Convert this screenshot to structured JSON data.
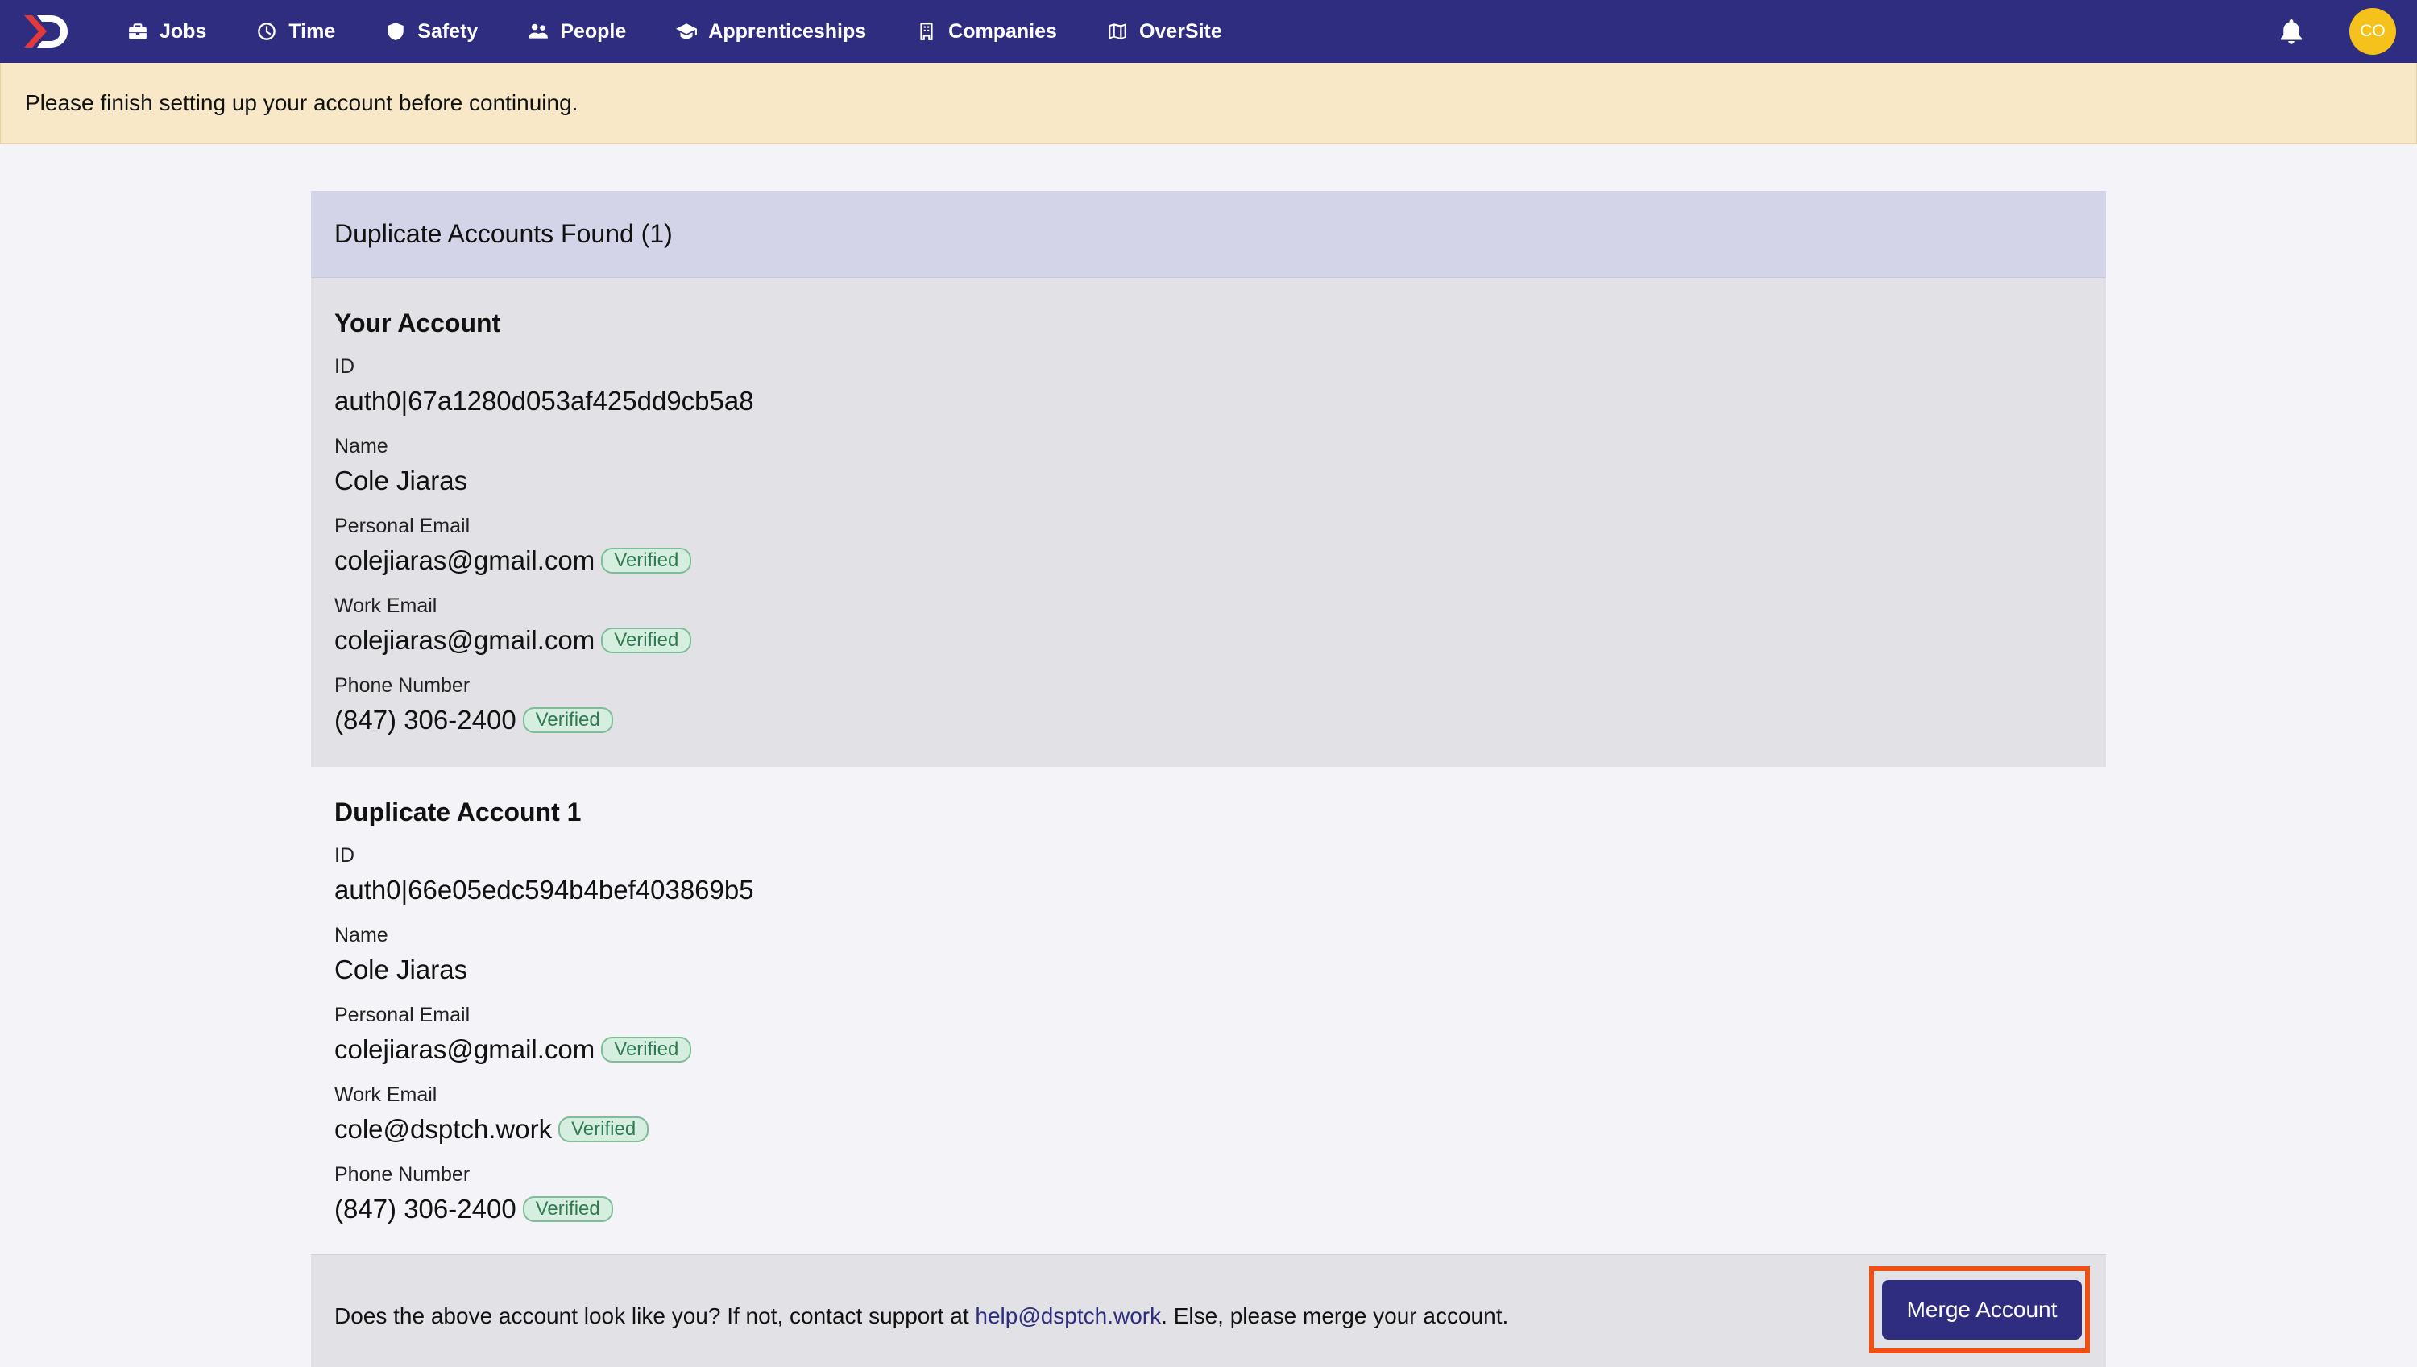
{
  "nav": {
    "items": [
      {
        "label": "Jobs",
        "icon": "briefcase-icon"
      },
      {
        "label": "Time",
        "icon": "clock-icon"
      },
      {
        "label": "Safety",
        "icon": "shield-icon"
      },
      {
        "label": "People",
        "icon": "people-icon"
      },
      {
        "label": "Apprenticeships",
        "icon": "graduation-cap-icon"
      },
      {
        "label": "Companies",
        "icon": "building-icon"
      },
      {
        "label": "OverSite",
        "icon": "map-icon"
      }
    ],
    "avatar_initials": "CO",
    "brand_color": "#2f2d7f",
    "avatar_color": "#f5c21b"
  },
  "banner": {
    "message": "Please finish setting up your account before continuing."
  },
  "card": {
    "title": "Duplicate Accounts Found (1)",
    "your_account": {
      "heading": "Your Account",
      "id_label": "ID",
      "id": "auth0|67a1280d053af425dd9cb5a8",
      "name_label": "Name",
      "name": "Cole Jiaras",
      "personal_email_label": "Personal Email",
      "personal_email": "colejiaras@gmail.com",
      "work_email_label": "Work Email",
      "work_email": "colejiaras@gmail.com",
      "phone_label": "Phone Number",
      "phone": "(847) 306-2400",
      "verified_label": "Verified"
    },
    "duplicate_account": {
      "heading": "Duplicate Account 1",
      "id_label": "ID",
      "id": "auth0|66e05edc594b4bef403869b5",
      "name_label": "Name",
      "name": "Cole Jiaras",
      "personal_email_label": "Personal Email",
      "personal_email": "colejiaras@gmail.com",
      "work_email_label": "Work Email",
      "work_email": "cole@dsptch.work",
      "phone_label": "Phone Number",
      "phone": "(847) 306-2400",
      "verified_label": "Verified"
    },
    "footer": {
      "text_before": "Does the above account look like you? If not, contact support at ",
      "support_email": "help@dsptch.work",
      "text_after": ". Else, please merge your account.",
      "merge_button": "Merge Account"
    }
  }
}
